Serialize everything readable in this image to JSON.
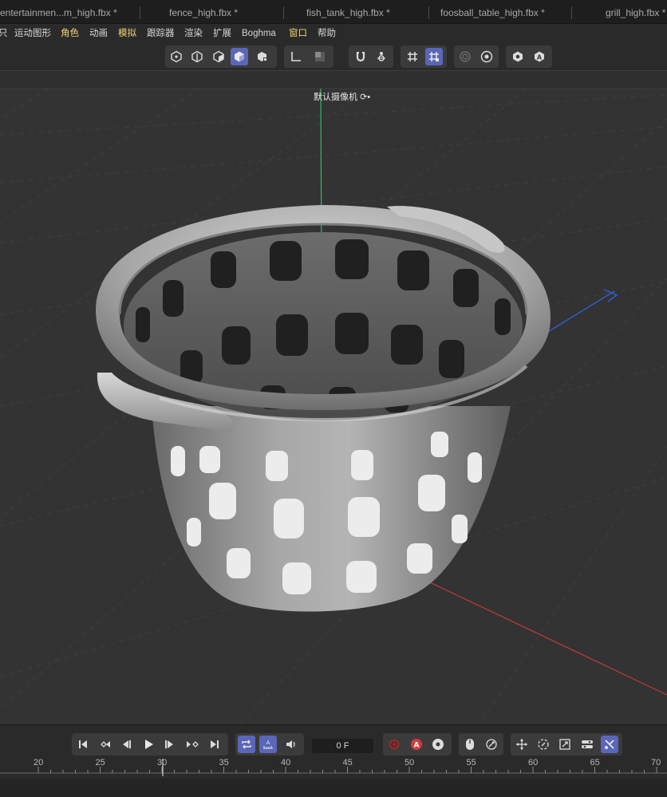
{
  "tabs": [
    {
      "label": "entertainmen...m_high.fbx *"
    },
    {
      "label": "fence_high.fbx *"
    },
    {
      "label": "fish_tank_high.fbx *"
    },
    {
      "label": "foosball_table_high.fbx *"
    },
    {
      "label": "grill_high.fbx *"
    }
  ],
  "menu": {
    "items": [
      {
        "label": "只",
        "accent": false
      },
      {
        "label": "运动图形",
        "accent": false
      },
      {
        "label": "角色",
        "accent": true
      },
      {
        "label": "动画",
        "accent": false
      },
      {
        "label": "模拟",
        "accent": true
      },
      {
        "label": "跟踪器",
        "accent": false
      },
      {
        "label": "渲染",
        "accent": false
      },
      {
        "label": "扩展",
        "accent": false
      },
      {
        "label": "Boghma",
        "accent": false
      },
      {
        "label": "窗口",
        "accent": true
      },
      {
        "label": "帮助",
        "accent": false
      }
    ]
  },
  "viewport": {
    "camera_label": "默认摄像机",
    "camera_suffix": "⟳•"
  },
  "timeline": {
    "current_frame": "0 F",
    "ticks": [
      "20",
      "25",
      "30",
      "35",
      "40",
      "45",
      "50",
      "55",
      "60",
      "65",
      "70"
    ]
  },
  "colors": {
    "active_button": "#5a66b8",
    "axis_x": "#c23a3a",
    "axis_y": "#35b86b",
    "axis_z": "#2f5fd0",
    "menu_accent": "#f0d27a",
    "record_active": "#d23b3b"
  }
}
